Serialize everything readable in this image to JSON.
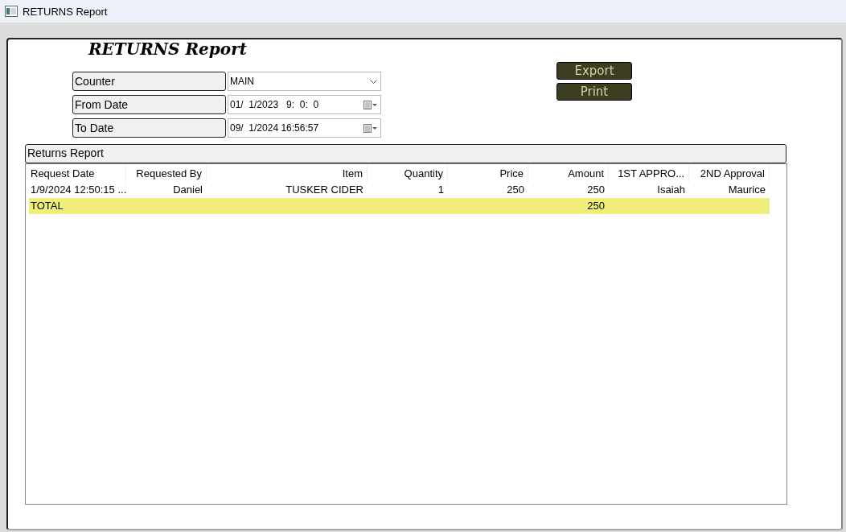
{
  "window": {
    "title": "RETURNS Report"
  },
  "heading": "RETURNS Report",
  "filters": [
    {
      "label": "Counter",
      "kind": "combo",
      "value": "MAIN"
    },
    {
      "label": "From Date",
      "kind": "date",
      "value": "01/  1/2023   9:  0:  0"
    },
    {
      "label": "To Date",
      "kind": "date",
      "value": "09/  1/2024 16:56:57"
    }
  ],
  "buttons": [
    "Export",
    "Print"
  ],
  "section_title": "Returns Report",
  "table": {
    "columns": [
      "Request Date",
      "Requested By",
      "Item",
      "Quantity",
      "Price",
      "Amount",
      "1ST APPRO...",
      "2ND Approval"
    ],
    "rows": [
      {
        "kind": "data",
        "cells": [
          "1/9/2024 12:50:15 ...",
          "Daniel",
          "TUSKER CIDER",
          "1",
          "250",
          "250",
          "Isaiah",
          "Maurice"
        ]
      },
      {
        "kind": "total",
        "cells": [
          "TOTAL",
          "",
          "",
          "",
          "",
          "250",
          "",
          ""
        ]
      }
    ]
  }
}
